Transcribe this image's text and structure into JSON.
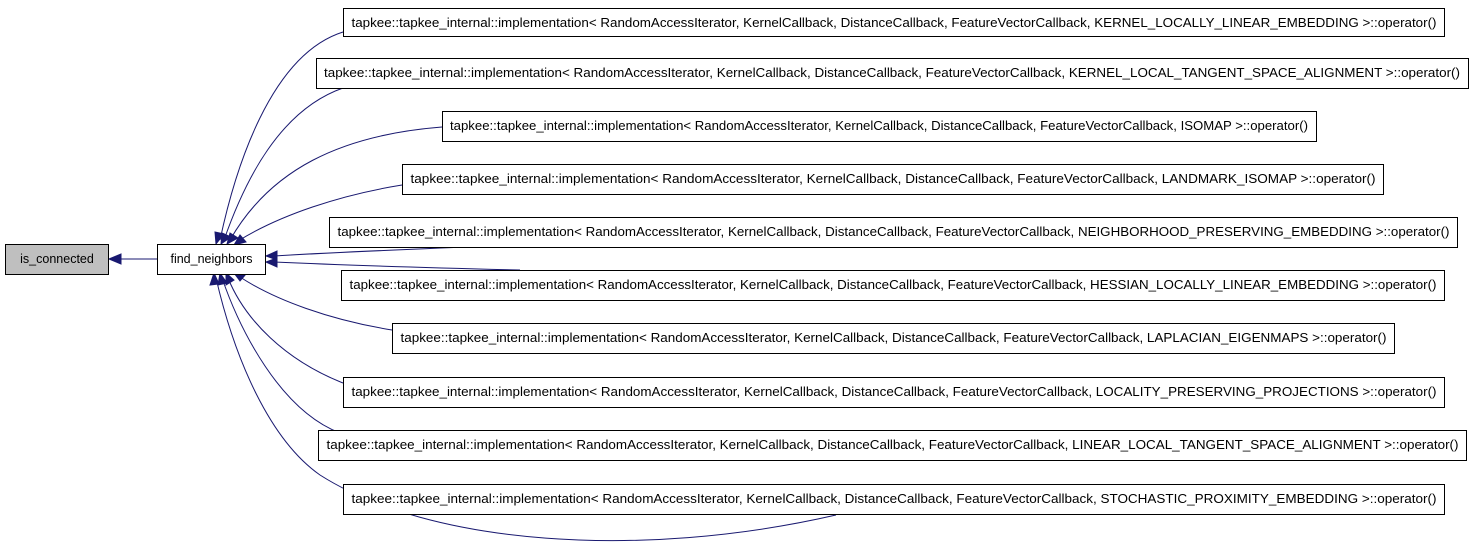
{
  "graph": {
    "root": {
      "label": "is_connected",
      "is_current": true
    },
    "center": {
      "label": "find_neighbors"
    },
    "callers": [
      {
        "label": "tapkee::tapkee_internal::implementation< RandomAccessIterator, KernelCallback, DistanceCallback, FeatureVectorCallback, KERNEL_LOCALLY_LINEAR_EMBEDDING >::operator()"
      },
      {
        "label": "tapkee::tapkee_internal::implementation< RandomAccessIterator, KernelCallback, DistanceCallback, FeatureVectorCallback, KERNEL_LOCAL_TANGENT_SPACE_ALIGNMENT >::operator()"
      },
      {
        "label": "tapkee::tapkee_internal::implementation< RandomAccessIterator, KernelCallback, DistanceCallback, FeatureVectorCallback, ISOMAP >::operator()"
      },
      {
        "label": "tapkee::tapkee_internal::implementation< RandomAccessIterator, KernelCallback, DistanceCallback, FeatureVectorCallback, LANDMARK_ISOMAP >::operator()"
      },
      {
        "label": "tapkee::tapkee_internal::implementation< RandomAccessIterator, KernelCallback, DistanceCallback, FeatureVectorCallback, NEIGHBORHOOD_PRESERVING_EMBEDDING >::operator()"
      },
      {
        "label": "tapkee::tapkee_internal::implementation< RandomAccessIterator, KernelCallback, DistanceCallback, FeatureVectorCallback, HESSIAN_LOCALLY_LINEAR_EMBEDDING >::operator()"
      },
      {
        "label": "tapkee::tapkee_internal::implementation< RandomAccessIterator, KernelCallback, DistanceCallback, FeatureVectorCallback, LAPLACIAN_EIGENMAPS >::operator()"
      },
      {
        "label": "tapkee::tapkee_internal::implementation< RandomAccessIterator, KernelCallback, DistanceCallback, FeatureVectorCallback, LOCALITY_PRESERVING_PROJECTIONS >::operator()"
      },
      {
        "label": "tapkee::tapkee_internal::implementation< RandomAccessIterator, KernelCallback, DistanceCallback, FeatureVectorCallback, LINEAR_LOCAL_TANGENT_SPACE_ALIGNMENT >::operator()"
      },
      {
        "label": "tapkee::tapkee_internal::implementation< RandomAccessIterator, KernelCallback, DistanceCallback, FeatureVectorCallback, STOCHASTIC_PROXIMITY_EMBEDDING >::operator()"
      }
    ],
    "colors": {
      "edge": "#191970",
      "current_node_fill": "#bfbfbf",
      "node_fill": "#ffffff",
      "node_border": "#000000"
    }
  }
}
